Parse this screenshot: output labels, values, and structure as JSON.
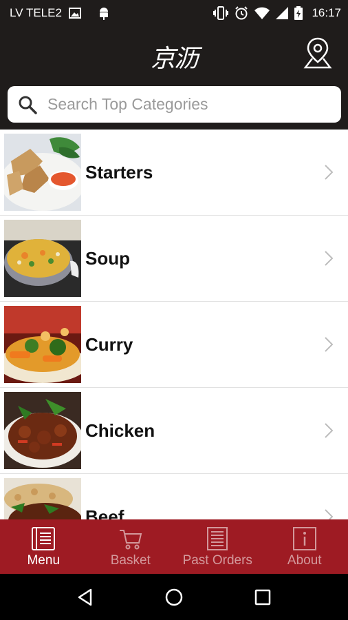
{
  "status_bar": {
    "carrier": "LV TELE2",
    "time": "16:17",
    "icons": [
      "image-icon",
      "android-icon",
      "vibrate-icon",
      "alarm-icon",
      "wifi-icon",
      "signal-icon",
      "battery-charging-icon"
    ]
  },
  "header": {
    "logo_text": "京沥",
    "location_icon": "map-location-icon"
  },
  "search": {
    "placeholder": "Search Top Categories",
    "icon": "search-icon"
  },
  "categories": [
    {
      "label": "Starters",
      "image": "starters-dish-image"
    },
    {
      "label": "Soup",
      "image": "soup-dish-image"
    },
    {
      "label": "Curry",
      "image": "curry-dish-image"
    },
    {
      "label": "Chicken",
      "image": "chicken-dish-image"
    },
    {
      "label": "Beef",
      "image": "beef-dish-image"
    }
  ],
  "tabs": [
    {
      "label": "Menu",
      "icon": "menu-book-icon",
      "active": true
    },
    {
      "label": "Basket",
      "icon": "cart-icon",
      "active": false
    },
    {
      "label": "Past Orders",
      "icon": "receipt-icon",
      "active": false
    },
    {
      "label": "About",
      "icon": "info-icon",
      "active": false
    }
  ],
  "colors": {
    "header_bg": "#1f1c1b",
    "tabbar_bg": "#9e1b23",
    "nav_bg": "#000000"
  }
}
